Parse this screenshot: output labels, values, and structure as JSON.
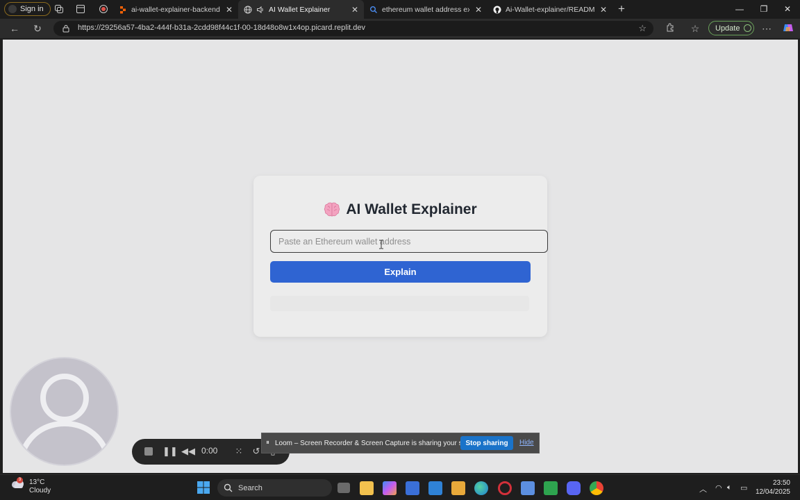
{
  "browser": {
    "signin_label": "Sign in",
    "tabs": [
      {
        "title": "ai-wallet-explainer-backend - Rep",
        "favicon": "replit-icon",
        "active": false
      },
      {
        "title": "AI Wallet Explainer",
        "favicon": "speaker-icon",
        "active": true
      },
      {
        "title": "ethereum wallet address example",
        "favicon": "search-icon",
        "active": false
      },
      {
        "title": "Ai-Wallet-explainer/README.md",
        "favicon": "github-icon",
        "active": false
      }
    ],
    "url": "https://29256a57-4ba2-444f-b31a-2cdd98f44c1f-00-18d48o8w1x4op.picard.replit.dev",
    "update_label": "Update"
  },
  "app": {
    "title": "AI Wallet Explainer",
    "title_emoji_icon": "brain-icon",
    "input_placeholder": "Paste an Ethereum wallet address",
    "input_value": "",
    "button_label": "Explain"
  },
  "loom": {
    "time": "0:00",
    "share_message": "Loom – Screen Recorder & Screen Capture is sharing your screen.",
    "stop_label": "Stop sharing",
    "hide_label": "Hide"
  },
  "taskbar": {
    "weather_temp": "13°C",
    "weather_desc": "Cloudy",
    "weather_badge": "3",
    "search_label": "Search",
    "time": "23:50",
    "date": "12/04/2025"
  },
  "colors": {
    "accent": "#2f64d2",
    "page_bg": "#e5e5e6",
    "card_bg": "#ececec",
    "stop_button": "#1a73c9"
  }
}
